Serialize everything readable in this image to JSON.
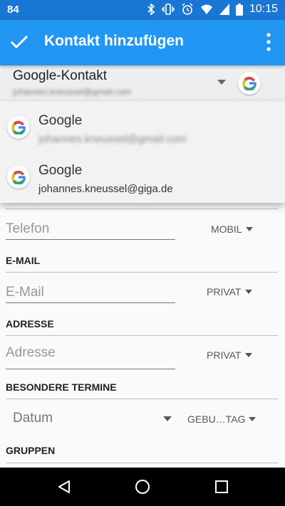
{
  "status_bar": {
    "battery_level": "84",
    "time": "10:15"
  },
  "toolbar": {
    "title": "Kontakt hinzufügen",
    "check_icon": "check-icon",
    "more_icon": "more-vert-icon"
  },
  "account": {
    "type_label": "Google-Kontakt",
    "email_obscured": "johannes.kneussel@gmail.com"
  },
  "dropdown": {
    "items": [
      {
        "label": "Google",
        "email": "johannes.kneussel@gmail.com",
        "email_blurred": true
      },
      {
        "label": "Google",
        "email": "johannes.kneussel@giga.de",
        "email_blurred": false
      }
    ]
  },
  "form": {
    "phone": {
      "placeholder": "Telefon",
      "type": "MOBIL"
    },
    "email_section": "E-MAIL",
    "email": {
      "placeholder": "E-Mail",
      "type": "PRIVAT"
    },
    "address_section": "ADRESSE",
    "address": {
      "placeholder": "Adresse",
      "type": "PRIVAT"
    },
    "events_section": "BESONDERE TERMINE",
    "date": {
      "placeholder": "Datum",
      "type": "GEBU…TAG"
    },
    "groups_section": "GRUPPEN"
  },
  "colors": {
    "status_bar": "#1976d2",
    "toolbar": "#2196f3"
  }
}
